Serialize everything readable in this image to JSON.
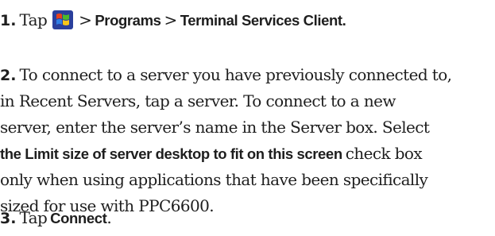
{
  "step1": {
    "number": "1.",
    "tap": "Tap",
    "icon": "windows-start-icon",
    "sep1": ">",
    "programs": "Programs",
    "sep2": ">",
    "terminal": "Terminal Services Client."
  },
  "step2": {
    "number": "2.",
    "line1": "To connect to a server you have previously connected to,",
    "line2": "in Recent Servers, tap a server. To connect to a new",
    "line3": "server, enter the server’s name in the Server box. Select",
    "line4_bold": "the Limit size of server desktop to fit on this screen",
    "line4_rest": "check box",
    "line5": "only when using applications that have been specifically",
    "line6": "sized for use with PPC6600."
  },
  "step3": {
    "number": "3.",
    "tap": "Tap",
    "connect": "Connect",
    "period": "."
  }
}
